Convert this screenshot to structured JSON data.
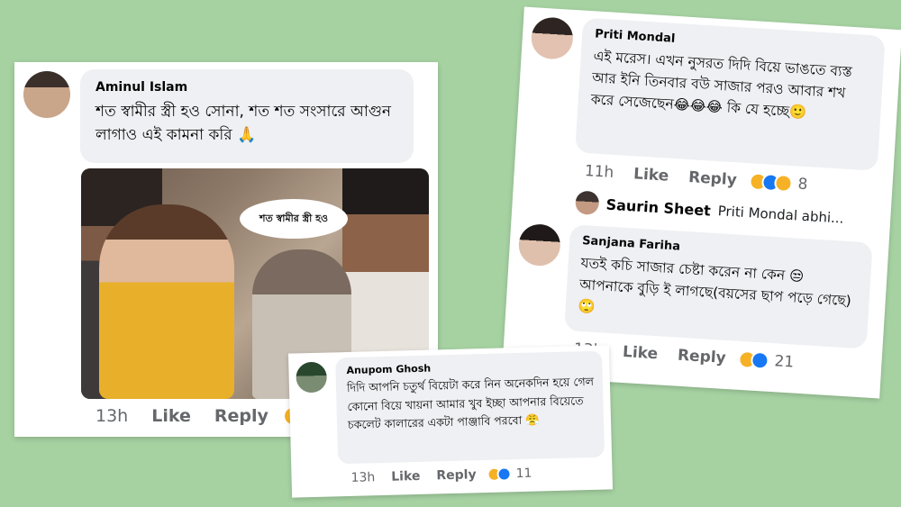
{
  "comments": [
    {
      "author": "Aminul Islam",
      "text": "শত স্বামীর স্ত্রী হও সোনা, শত শত সংসারে আগুন লাগাও এই কামনা করি 🙏",
      "meme_caption": "শত স্বামীর স্ত্রী হও",
      "time": "13h",
      "like": "Like",
      "reply": "Reply"
    },
    {
      "author": "Priti Mondal",
      "text": "এই মরেস।  এখন নুসরত দিদি বিয়ে ভাঙতে ব্যস্ত আর ইনি তিনবার বউ সাজার পরও আবার শখ করে সেজেছেন😂😂😂 কি যে হচ্ছে🙂",
      "time": "11h",
      "like": "Like",
      "reply": "Reply",
      "reaction_count": "8"
    },
    {
      "reply_author": "Saurin Sheet",
      "reply_preview": "Priti Mondal abhi..."
    },
    {
      "author": "Sanjana Fariha",
      "text": "যতই কচি সাজার চেষ্টা করেন না কেন 😒 আপনাকে বুড়ি ই লাগছে(বয়সের ছাপ পড়ে গেছে)🙄",
      "time": "13h",
      "like": "Like",
      "reply": "Reply",
      "reaction_count": "21"
    },
    {
      "author": "Anupom Ghosh",
      "text": "দিদি আপনি চতুর্থ বিয়েটা করে নিন অনেকদিন হয়ে গেল কোনো বিয়ে খায়না আমার খুব ইচ্ছা  আপনার বিয়েতে চকলেট কালারের  একটা পাঞ্জাবি পরবো 😤",
      "time": "13h",
      "like": "Like",
      "reply": "Reply",
      "reaction_count": "11"
    }
  ],
  "colors": {
    "background": "#a6d2a2",
    "bubble": "#eef0f3",
    "meta_text": "#65676b",
    "like_blue": "#1877f2",
    "haha_yellow": "#f7b125"
  }
}
